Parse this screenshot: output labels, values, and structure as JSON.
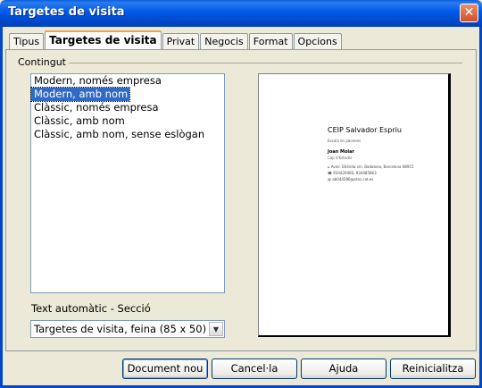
{
  "window": {
    "title": "Targetes de visita",
    "close_label": "✕"
  },
  "tabs": [
    {
      "label": "Tipus"
    },
    {
      "label": "Targetes de visita"
    },
    {
      "label": "Privat"
    },
    {
      "label": "Negocis"
    },
    {
      "label": "Format"
    },
    {
      "label": "Opcions"
    }
  ],
  "content": {
    "group_label": "Contingut",
    "list_items": [
      "Modern, només empresa",
      "Modern, amb nom",
      "Clàssic, només empresa",
      "Clàssic, amb nom",
      "Clàssic, amb nom, sense eslògan"
    ],
    "selected_index": 1,
    "auto_text_label": "Text automàtic - Secció",
    "auto_text_value": "Targetes de visita, feina (85 x 50)"
  },
  "preview": {
    "company": "CEIP Salvador Espriu",
    "slogan": "Escola en pàcenes",
    "name": "Joan Molar",
    "role": "Cap d'Estudis",
    "address": "Avinr. Etiénita s/n, Badalona, Barcelona 08915",
    "phone": "934420460, 934485863",
    "email": "ab044286@xtec.cat.es"
  },
  "buttons": {
    "new_document": "Document nou",
    "cancel": "Cancel·la",
    "help": "Ajuda",
    "reset": "Reinicialitza"
  },
  "colors": {
    "title_bar": "#0058e6",
    "selection": "#316ac5",
    "active_tab_accent": "#f0a83c"
  }
}
